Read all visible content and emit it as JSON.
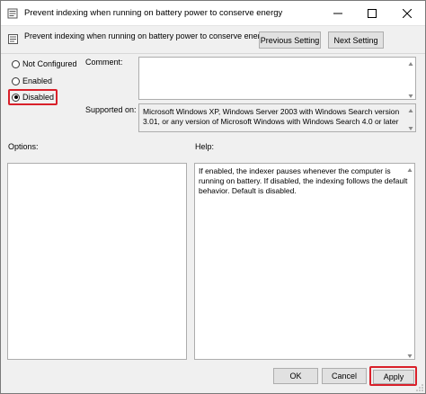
{
  "window": {
    "title": "Prevent indexing when running on battery power to conserve energy"
  },
  "header": {
    "policy_name": "Prevent indexing when running on battery power to conserve energy",
    "previous_button": "Previous Setting",
    "next_button": "Next Setting"
  },
  "state": {
    "options": [
      {
        "label": "Not Configured",
        "selected": false
      },
      {
        "label": "Enabled",
        "selected": false
      },
      {
        "label": "Disabled",
        "selected": true
      }
    ]
  },
  "comment": {
    "label": "Comment:",
    "value": ""
  },
  "supported": {
    "label": "Supported on:",
    "value": "Microsoft Windows XP, Windows Server 2003 with Windows Search version 3.01, or any version of Microsoft Windows with Windows Search 4.0 or later"
  },
  "options_panel": {
    "label": "Options:"
  },
  "help_panel": {
    "label": "Help:",
    "text": "If enabled, the indexer pauses whenever the computer is running on battery. If disabled, the indexing follows the default behavior. Default is disabled."
  },
  "footer": {
    "ok": "OK",
    "cancel": "Cancel",
    "apply": "Apply"
  },
  "colors": {
    "highlight": "#d9202a",
    "window_bg": "#f0f0f0",
    "button_bg": "#e1e1e1"
  },
  "icons": [
    "policy-icon",
    "minimize-icon",
    "maximize-icon",
    "close-icon",
    "scroll-up-icon",
    "scroll-down-icon",
    "resize-grip-icon"
  ]
}
